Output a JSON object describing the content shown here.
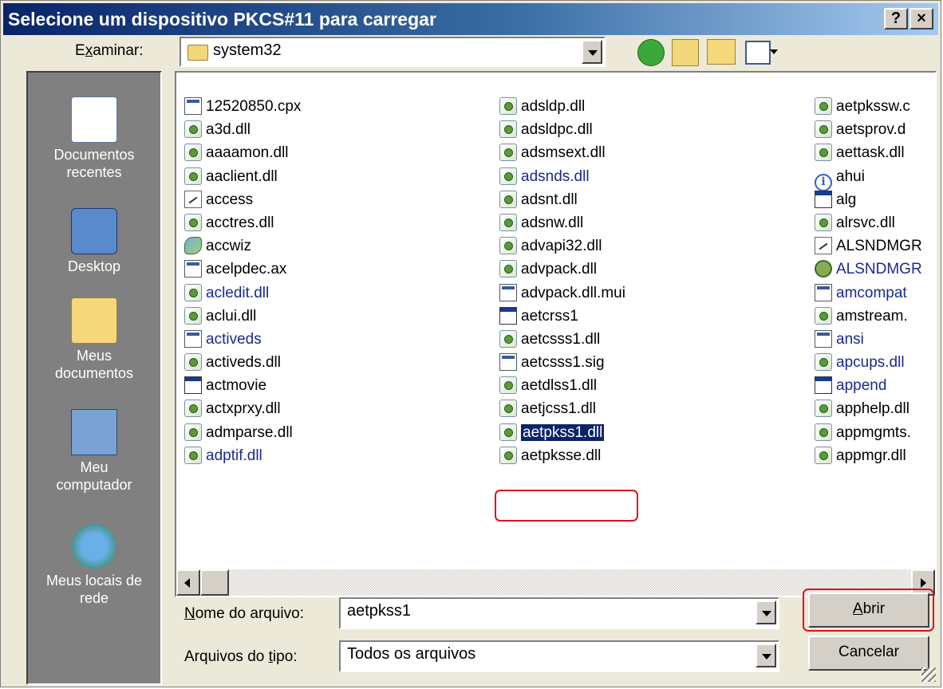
{
  "window": {
    "title": "Selecione um dispositivo PKCS#11 para carregar",
    "help_button": "?",
    "close_button": "×"
  },
  "toolbar": {
    "look_in_label_pre": "E",
    "look_in_label_u": "x",
    "look_in_label_post": "aminar:",
    "look_in_value": "system32"
  },
  "places": [
    {
      "label_line1": "Documentos",
      "label_line2": "recentes",
      "icon": "recent-documents-icon"
    },
    {
      "label_line1": "Desktop",
      "label_line2": "",
      "icon": "desktop-icon"
    },
    {
      "label_line1": "Meus",
      "label_line2": "documentos",
      "icon": "my-documents-icon"
    },
    {
      "label_line1": "Meu",
      "label_line2": "computador",
      "icon": "my-computer-icon"
    },
    {
      "label_line1": "Meus locais de",
      "label_line2": "rede",
      "icon": "network-places-icon"
    }
  ],
  "files": {
    "col1": [
      {
        "name": "12520850.cpx",
        "icon": "gen",
        "blue": false
      },
      {
        "name": "a3d.dll",
        "icon": "dll",
        "blue": false
      },
      {
        "name": "aaaamon.dll",
        "icon": "dll",
        "blue": false
      },
      {
        "name": "aaclient.dll",
        "icon": "dll",
        "blue": false
      },
      {
        "name": "access",
        "icon": "txt",
        "blue": false
      },
      {
        "name": "acctres.dll",
        "icon": "dll",
        "blue": false
      },
      {
        "name": "accwiz",
        "icon": "wiz",
        "blue": false
      },
      {
        "name": "acelpdec.ax",
        "icon": "gen",
        "blue": false
      },
      {
        "name": "acledit.dll",
        "icon": "dll",
        "blue": true
      },
      {
        "name": "aclui.dll",
        "icon": "dll",
        "blue": false
      },
      {
        "name": "activeds",
        "icon": "gen",
        "blue": true
      },
      {
        "name": "activeds.dll",
        "icon": "dll",
        "blue": false
      },
      {
        "name": "actmovie",
        "icon": "app",
        "blue": false
      },
      {
        "name": "actxprxy.dll",
        "icon": "dll",
        "blue": false
      },
      {
        "name": "admparse.dll",
        "icon": "dll",
        "blue": false
      },
      {
        "name": "adptif.dll",
        "icon": "dll",
        "blue": true
      }
    ],
    "col2": [
      {
        "name": "adsldp.dll",
        "icon": "dll",
        "blue": false
      },
      {
        "name": "adsldpc.dll",
        "icon": "dll",
        "blue": false
      },
      {
        "name": "adsmsext.dll",
        "icon": "dll",
        "blue": false
      },
      {
        "name": "adsnds.dll",
        "icon": "dll",
        "blue": true
      },
      {
        "name": "adsnt.dll",
        "icon": "dll",
        "blue": false
      },
      {
        "name": "adsnw.dll",
        "icon": "dll",
        "blue": false
      },
      {
        "name": "advapi32.dll",
        "icon": "dll",
        "blue": false
      },
      {
        "name": "advpack.dll",
        "icon": "dll",
        "blue": false
      },
      {
        "name": "advpack.dll.mui",
        "icon": "gen",
        "blue": false
      },
      {
        "name": "aetcrss1",
        "icon": "app",
        "blue": false
      },
      {
        "name": "aetcsss1.dll",
        "icon": "dll",
        "blue": false
      },
      {
        "name": "aetcsss1.sig",
        "icon": "gen",
        "blue": false
      },
      {
        "name": "aetdlss1.dll",
        "icon": "dll",
        "blue": false
      },
      {
        "name": "aetjcss1.dll",
        "icon": "dll",
        "blue": false
      },
      {
        "name": "aetpkss1.dll",
        "icon": "dll",
        "blue": false,
        "selected": true
      },
      {
        "name": "aetpksse.dll",
        "icon": "dll",
        "blue": false
      }
    ],
    "col3": [
      {
        "name": "aetpkssw.c",
        "icon": "dll",
        "blue": false
      },
      {
        "name": "aetsprov.d",
        "icon": "dll",
        "blue": false
      },
      {
        "name": "aettask.dll",
        "icon": "dll",
        "blue": false
      },
      {
        "name": "ahui",
        "icon": "info",
        "blue": false
      },
      {
        "name": "alg",
        "icon": "app",
        "blue": false
      },
      {
        "name": "alrsvc.dll",
        "icon": "dll",
        "blue": false
      },
      {
        "name": "ALSNDMGR",
        "icon": "txt",
        "blue": false
      },
      {
        "name": "ALSNDMGR",
        "icon": "grn",
        "blue": true
      },
      {
        "name": "amcompat",
        "icon": "gen",
        "blue": true
      },
      {
        "name": "amstream.",
        "icon": "dll",
        "blue": false
      },
      {
        "name": "ansi",
        "icon": "gen",
        "blue": true
      },
      {
        "name": "apcups.dll",
        "icon": "dll",
        "blue": true
      },
      {
        "name": "append",
        "icon": "app",
        "blue": true
      },
      {
        "name": "apphelp.dll",
        "icon": "dll",
        "blue": false
      },
      {
        "name": "appmgmts.",
        "icon": "dll",
        "blue": false
      },
      {
        "name": "appmgr.dll",
        "icon": "dll",
        "blue": false
      }
    ]
  },
  "filename": {
    "label_u": "N",
    "label_rest": "ome do arquivo:",
    "value": "aetpkss1"
  },
  "filetype": {
    "label_pre": "Arquivos do ",
    "label_u": "t",
    "label_post": "ipo:",
    "value": "Todos os arquivos"
  },
  "buttons": {
    "open_u": "A",
    "open_rest": "brir",
    "cancel": "Cancelar"
  },
  "colors": {
    "title_start": "#0a246a",
    "title_end": "#a6caf0",
    "highlight": "#e0101c",
    "selection": "#0a246a"
  }
}
